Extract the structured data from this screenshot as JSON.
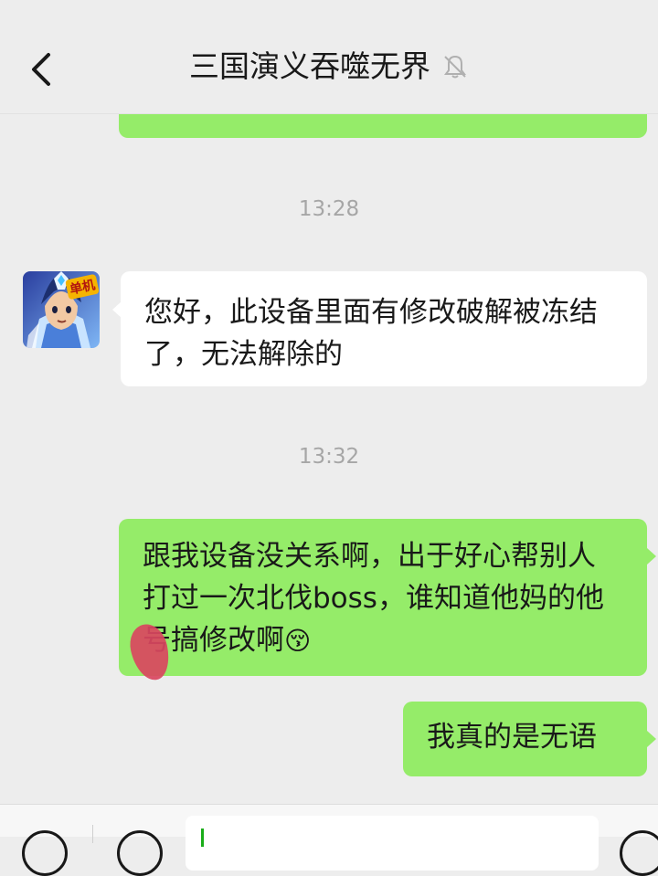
{
  "header": {
    "title": "三国演义吞噬无界",
    "back_icon": "chevron-left-icon",
    "mute_icon": "bell-muted-icon"
  },
  "messages": {
    "cut_top_text": "",
    "time1": "13:28",
    "them1": "您好，此设备里面有修改破解被冻结了，无法解除的",
    "avatar_badge": "单机",
    "time2": "13:32",
    "me1": "跟我设备没关系啊，出于好心帮别人打过一次北伐boss，谁知道他妈的他号搞修改啊",
    "me1_emoji": "😚",
    "me2": "我真的是无语"
  },
  "colors": {
    "background": "#ededed",
    "my_bubble": "#95ec69",
    "their_bubble": "#ffffff",
    "timestamp": "#a6a6a6"
  },
  "bottom": {
    "voice_icon": "voice-icon",
    "emoji_icon": "emoji-icon",
    "plus_icon": "plus-icon"
  }
}
